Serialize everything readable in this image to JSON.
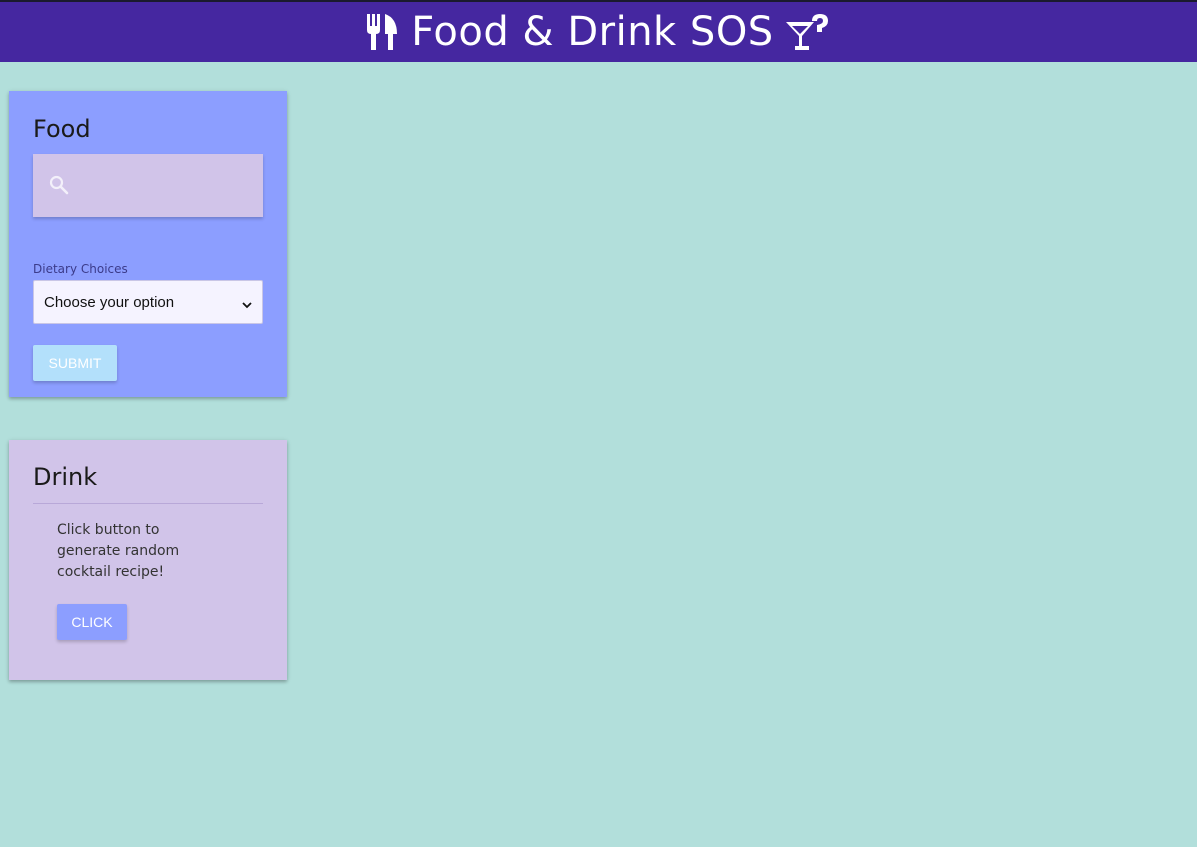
{
  "header": {
    "title": "Food & Drink SOS",
    "left_icon": "utensils-icon",
    "right_icon": "cocktail-question-icon"
  },
  "food": {
    "title": "Food",
    "search": {
      "icon": "search-icon",
      "value": "",
      "placeholder": ""
    },
    "dietary_label": "Dietary Choices",
    "dietary_selected": "Choose your option",
    "submit_label": "SUBMIT"
  },
  "drink": {
    "title": "Drink",
    "description": "Click button to generate random cocktail recipe!",
    "click_label": "CLICK"
  },
  "colors": {
    "page_background": "#b2dfdb",
    "header": "#4527a0",
    "food_card": "#8c9eff",
    "drink_card": "#d1c4e9",
    "submit_button": "#b3e0fb",
    "click_button": "#8c9eff"
  }
}
